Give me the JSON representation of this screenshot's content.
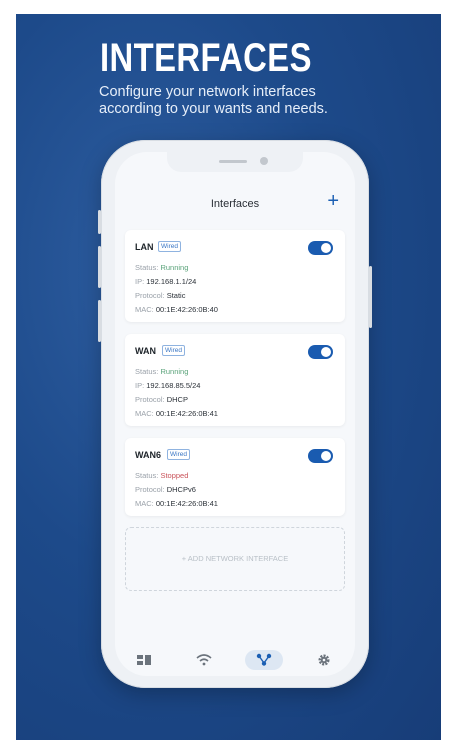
{
  "promo": {
    "headline": "INTERFACES",
    "subtitle_line1": "Configure your network interfaces",
    "subtitle_line2": "according to your wants and needs."
  },
  "app": {
    "title": "Interfaces",
    "add_icon": "plus-icon",
    "accent_color": "#1a5bb0"
  },
  "interfaces": [
    {
      "name": "LAN",
      "badge": "Wired",
      "enabled": true,
      "status_label": "Status:",
      "status": "Running",
      "ip_label": "IP:",
      "ip": "192.168.1.1/24",
      "protocol_label": "Protocol:",
      "protocol": "Static",
      "mac_label": "MAC:",
      "mac": "00:1E:42:26:0B:40"
    },
    {
      "name": "WAN",
      "badge": "Wired",
      "enabled": true,
      "status_label": "Status:",
      "status": "Running",
      "ip_label": "IP:",
      "ip": "192.168.85.5/24",
      "protocol_label": "Protocol:",
      "protocol": "DHCP",
      "mac_label": "MAC:",
      "mac": "00:1E:42:26:0B:41"
    },
    {
      "name": "WAN6",
      "badge": "Wired",
      "enabled": true,
      "status_label": "Status:",
      "status": "Stopped",
      "protocol_label": "Protocol:",
      "protocol": "DHCPv6",
      "mac_label": "MAC:",
      "mac": "00:1E:42:26:0B:41"
    }
  ],
  "add_interface": {
    "label": "+ ADD NETWORK INTERFACE"
  },
  "nav": [
    {
      "icon": "dashboard-icon",
      "active": false
    },
    {
      "icon": "wifi-icon",
      "active": false
    },
    {
      "icon": "network-topology-icon",
      "active": true
    },
    {
      "icon": "gear-icon",
      "active": false
    }
  ]
}
